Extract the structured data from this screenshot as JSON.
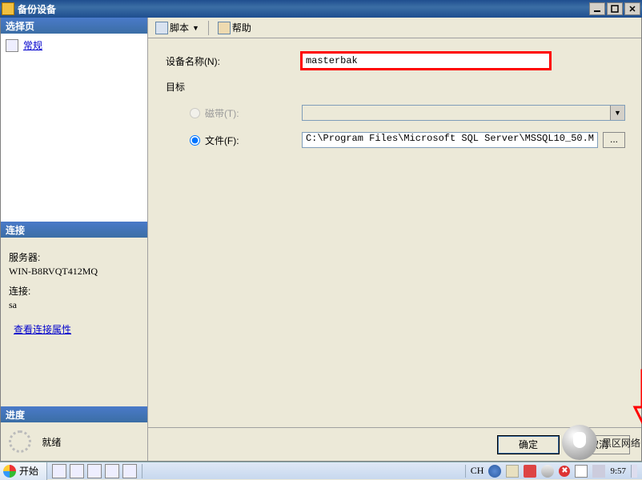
{
  "window": {
    "title": "备份设备"
  },
  "winbtns": {
    "min": "_",
    "max": "□",
    "close": "×"
  },
  "left": {
    "select_header": "选择页",
    "general_item": "常规",
    "conn_header": "连接",
    "server_label": "服务器:",
    "server_value": "WIN-B8RVQT412MQ",
    "connection_label": "连接:",
    "connection_value": "sa",
    "view_props": "查看连接属性",
    "progress_header": "进度",
    "ready": "就绪"
  },
  "toolbar": {
    "script": "脚本",
    "help": "帮助"
  },
  "form": {
    "device_name_label": "设备名称(N):",
    "device_name_value": "masterbak",
    "target_label": "目标",
    "tape_label": "磁带(T):",
    "file_label": "文件(F):",
    "file_value": "C:\\Program Files\\Microsoft SQL Server\\MSSQL10_50.M",
    "browse": "..."
  },
  "buttons": {
    "ok": "确定",
    "cancel": "取消"
  },
  "watermark": "黑区网络",
  "taskbar": {
    "start": "开始",
    "lang": "CH",
    "time": "9:57"
  }
}
